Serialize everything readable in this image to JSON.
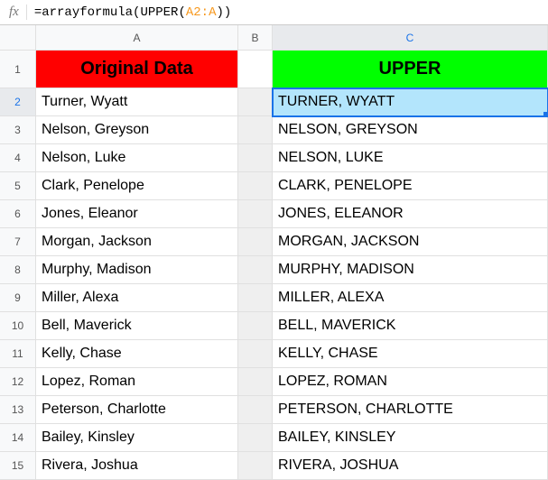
{
  "formula_bar": {
    "fx_label": "fx",
    "prefix": "=arrayformula(UPPER(",
    "ref": "A2:A",
    "suffix": "))"
  },
  "columns": {
    "A": "A",
    "B": "B",
    "C": "C"
  },
  "headers": {
    "A": "Original Data",
    "B": "",
    "C": "UPPER"
  },
  "selected_cell": "C2",
  "rows": [
    {
      "n": "1"
    },
    {
      "n": "2",
      "a": "Turner, Wyatt",
      "c": "TURNER, WYATT"
    },
    {
      "n": "3",
      "a": "Nelson, Greyson",
      "c": "NELSON, GREYSON"
    },
    {
      "n": "4",
      "a": "Nelson, Luke",
      "c": "NELSON, LUKE"
    },
    {
      "n": "5",
      "a": "Clark, Penelope",
      "c": "CLARK, PENELOPE"
    },
    {
      "n": "6",
      "a": "Jones, Eleanor",
      "c": "JONES, ELEANOR"
    },
    {
      "n": "7",
      "a": "Morgan, Jackson",
      "c": "MORGAN, JACKSON"
    },
    {
      "n": "8",
      "a": "Murphy, Madison",
      "c": "MURPHY, MADISON"
    },
    {
      "n": "9",
      "a": "Miller, Alexa",
      "c": "MILLER, ALEXA"
    },
    {
      "n": "10",
      "a": "Bell, Maverick",
      "c": "BELL, MAVERICK"
    },
    {
      "n": "11",
      "a": "Kelly, Chase",
      "c": "KELLY, CHASE"
    },
    {
      "n": "12",
      "a": "Lopez, Roman",
      "c": "LOPEZ, ROMAN"
    },
    {
      "n": "13",
      "a": "Peterson, Charlotte",
      "c": "PETERSON, CHARLOTTE"
    },
    {
      "n": "14",
      "a": "Bailey, Kinsley",
      "c": "BAILEY, KINSLEY"
    },
    {
      "n": "15",
      "a": "Rivera, Joshua",
      "c": "RIVERA, JOSHUA"
    }
  ]
}
